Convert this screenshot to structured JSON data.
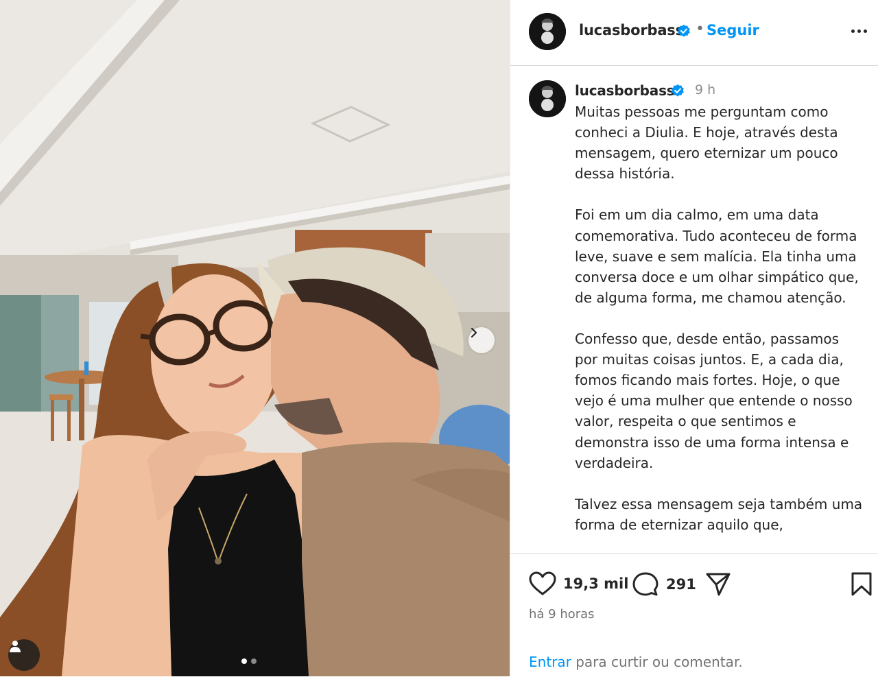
{
  "post": {
    "username": "lucasborbass",
    "follow_label": "Seguir",
    "separator": "•",
    "time_short": "9 h",
    "caption_paragraphs": [
      "Muitas pessoas me perguntam como conheci a Diulia. E hoje, através desta mensagem, quero eternizar um pouco dessa história.",
      "Foi em um dia calmo, em uma data comemorativa. Tudo aconteceu de forma leve, suave e sem malícia. Ela tinha uma conversa doce e um olhar simpático que, de alguma forma, me chamou atenção.",
      "Confesso que, desde então, passamos por muitas coisas juntos. E, a cada dia, fomos ficando mais fortes. Hoje, o que vejo é uma mulher que entende o nosso valor, respeita o que sentimos e demonstra isso de uma forma intensa e verdadeira.",
      "Talvez essa mensagem seja também uma forma de eternizar aquilo que,"
    ],
    "likes": "19,3 mil",
    "comments": "291",
    "time_long": "há 9 horas",
    "login_link": "Entrar",
    "login_text": " para curtir ou comentar."
  },
  "carousel": {
    "total_slides": 2,
    "active_slide": 1
  },
  "colors": {
    "link_blue": "#0095f6",
    "verified_blue": "#0095f6",
    "text": "#262626",
    "muted": "#737373"
  },
  "icons": {
    "verified": "verified-badge-icon",
    "more": "more-options-icon",
    "like": "heart-icon",
    "comment": "comment-bubble-icon",
    "share": "paper-plane-icon",
    "save": "bookmark-icon",
    "next": "chevron-right-icon",
    "tag": "person-icon"
  }
}
